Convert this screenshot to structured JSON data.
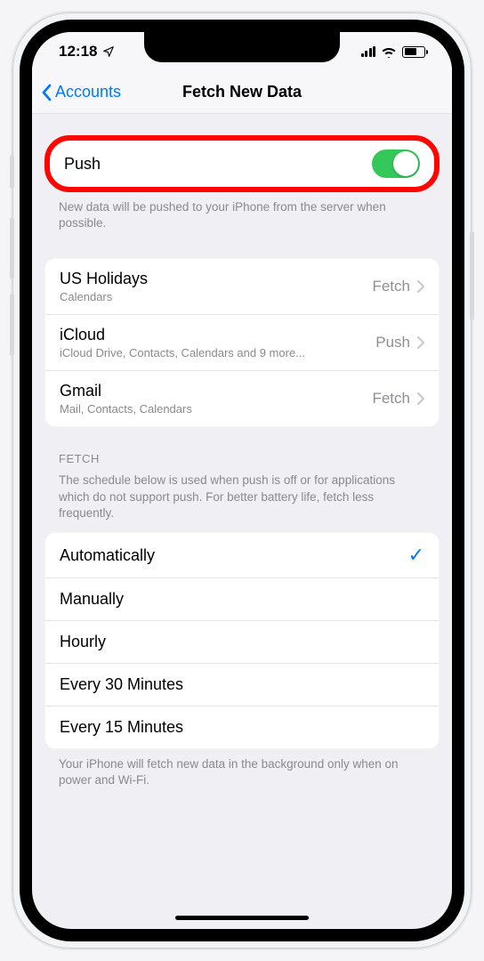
{
  "statusbar": {
    "time": "12:18"
  },
  "nav": {
    "back": "Accounts",
    "title": "Fetch New Data"
  },
  "push": {
    "label": "Push",
    "caption": "New data will be pushed to your iPhone from the server when possible."
  },
  "accounts": [
    {
      "name": "US Holidays",
      "detail": "Calendars",
      "mode": "Fetch"
    },
    {
      "name": "iCloud",
      "detail": "iCloud Drive, Contacts, Calendars and 9 more...",
      "mode": "Push"
    },
    {
      "name": "Gmail",
      "detail": "Mail, Contacts, Calendars",
      "mode": "Fetch"
    }
  ],
  "fetch": {
    "header": "FETCH",
    "caption": "The schedule below is used when push is off or for applications which do not support push. For better battery life, fetch less frequently.",
    "options": [
      {
        "label": "Automatically",
        "selected": true
      },
      {
        "label": "Manually",
        "selected": false
      },
      {
        "label": "Hourly",
        "selected": false
      },
      {
        "label": "Every 30 Minutes",
        "selected": false
      },
      {
        "label": "Every 15 Minutes",
        "selected": false
      }
    ],
    "footer": "Your iPhone will fetch new data in the background only when on power and Wi-Fi."
  }
}
